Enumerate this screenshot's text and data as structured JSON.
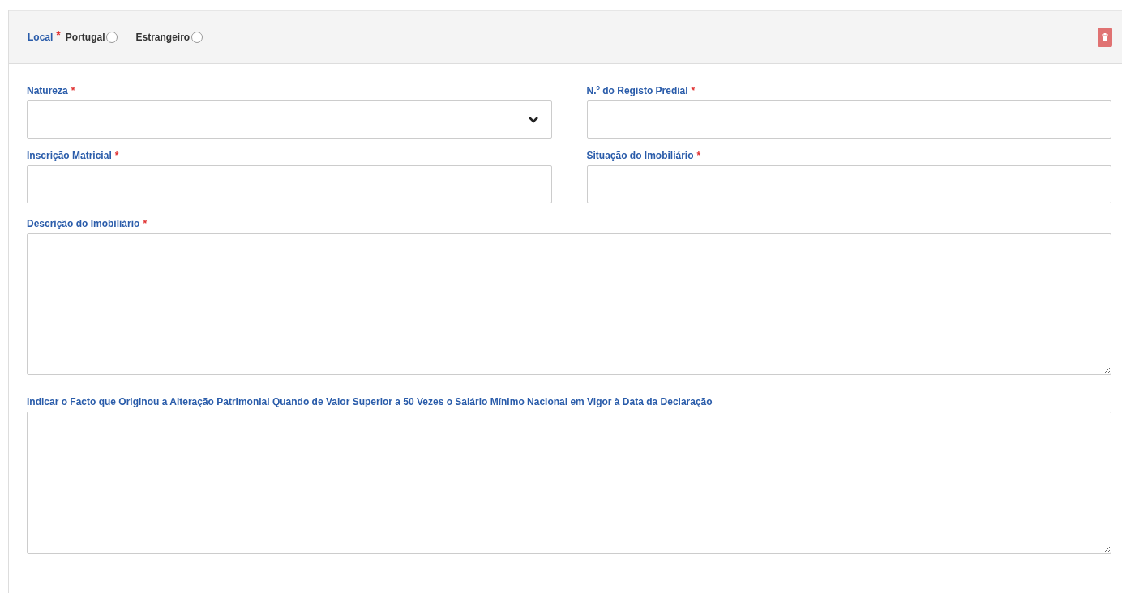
{
  "local": {
    "label": "Local",
    "required_mark": "*",
    "options": [
      {
        "label": "Portugal",
        "selected": false
      },
      {
        "label": "Estrangeiro",
        "selected": false
      }
    ]
  },
  "delete_button": {
    "kind": "trash"
  },
  "fields": [
    {
      "kind": "select",
      "label": "Natureza",
      "required_mark": "*"
    },
    {
      "kind": "text",
      "label": "N.º do Registo Predial",
      "required_mark": "*"
    },
    {
      "kind": "text",
      "label": "Inscrição Matricial",
      "required_mark": "*"
    },
    {
      "kind": "text",
      "label": "Situação do Imobiliário",
      "required_mark": "*"
    },
    {
      "kind": "textarea",
      "label": "Descrição do Imobiliário",
      "required_mark": "*"
    },
    {
      "kind": "textarea",
      "label": "Indicar o Facto que Originou a Alteração Patrimonial Quando de Valor Superior a 50 Vezes o Salário Mínimo Nacional em Vigor à Data da Declaração"
    }
  ]
}
